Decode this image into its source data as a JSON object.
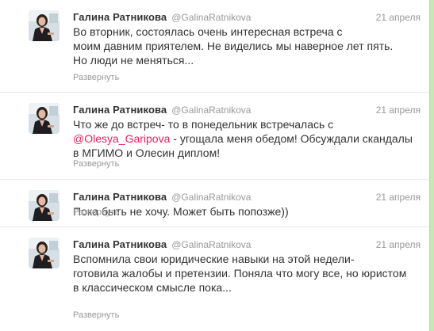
{
  "colors": {
    "accent_mention": "#e0245e",
    "text": "#333333",
    "muted": "#999999",
    "rail": "#c9e6b6"
  },
  "tweets": [
    {
      "name": "Галина Ратникова",
      "username": "@GalinaRatnikova",
      "date": "21 апреля",
      "lines": [
        "Во вторник, состоялась очень интересная встреча с",
        "моим давним приятелем. Не виделись мы наверное лет пять.",
        "Но люди не меняться..."
      ],
      "expand": "Развернуть",
      "avatar_icon": "user-avatar-icon"
    },
    {
      "name": "Галина Ратникова",
      "username": "@GalinaRatnikova",
      "date": "21 апреля",
      "line1": "Что же до встреч- то в понедельник встречалась с",
      "mention": "@Olesya_Garipova",
      "line2_rest": " - угощала меня обедом! Обсуждали скандалы",
      "line3": "в МГИМО и Олесин диплом!",
      "expand": "Развернуть",
      "avatar_icon": "user-avatar-icon"
    },
    {
      "name": "Галина Ратникова",
      "username": "@GalinaRatnikova",
      "date": "21 апреля",
      "lines": [
        "Пока быть не хочу. Может быть попозже))"
      ],
      "expand": "Развернуть",
      "avatar_icon": "user-avatar-icon"
    },
    {
      "name": "Галина Ратникова",
      "username": "@GalinaRatnikova",
      "date": "21 апреля",
      "lines": [
        "Вспомнила свои юридические навыки на этой недели-",
        "готовила жалобы и претензии. Поняла что могу все, но юристом",
        "в классическом смысле пока..."
      ],
      "expand": "Развернуть",
      "avatar_icon": "user-avatar-icon"
    }
  ]
}
